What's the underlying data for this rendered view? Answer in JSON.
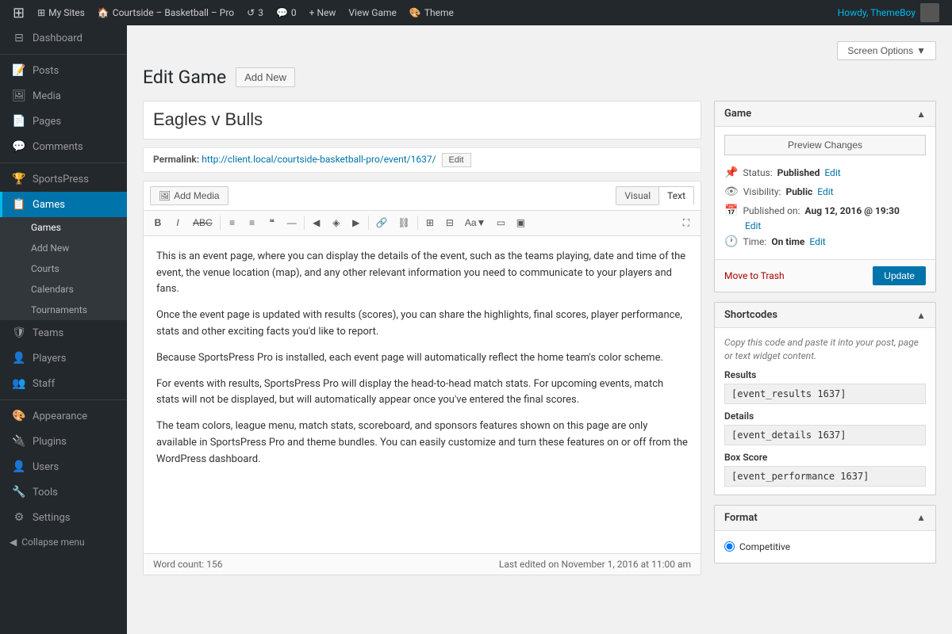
{
  "adminbar": {
    "wp_icon": "⊞",
    "items": [
      {
        "label": "My Sites",
        "icon": "⊞"
      },
      {
        "label": "Courtside – Basketball – Pro",
        "icon": "🏠"
      },
      {
        "label": "3",
        "icon": "↺"
      },
      {
        "label": "0",
        "icon": "💬"
      },
      {
        "label": "+ New",
        "icon": "+"
      },
      {
        "label": "View Game",
        "icon": ""
      },
      {
        "label": "Theme",
        "icon": "🎨"
      }
    ],
    "user": "Howdy, ThemeBoy"
  },
  "sidebar": {
    "items": [
      {
        "id": "dashboard",
        "label": "Dashboard",
        "icon": "⊟"
      },
      {
        "id": "posts",
        "label": "Posts",
        "icon": "📝"
      },
      {
        "id": "media",
        "label": "Media",
        "icon": "🖼"
      },
      {
        "id": "pages",
        "label": "Pages",
        "icon": "📄"
      },
      {
        "id": "comments",
        "label": "Comments",
        "icon": "💬"
      },
      {
        "id": "sportspress",
        "label": "SportsPress",
        "icon": "🏆"
      },
      {
        "id": "games",
        "label": "Games",
        "icon": "📋"
      },
      {
        "id": "teams",
        "label": "Teams",
        "icon": "🛡"
      },
      {
        "id": "players",
        "label": "Players",
        "icon": "👤"
      },
      {
        "id": "staff",
        "label": "Staff",
        "icon": "👥"
      },
      {
        "id": "appearance",
        "label": "Appearance",
        "icon": "🎨"
      },
      {
        "id": "plugins",
        "label": "Plugins",
        "icon": "🔌"
      },
      {
        "id": "users",
        "label": "Users",
        "icon": "👤"
      },
      {
        "id": "tools",
        "label": "Tools",
        "icon": "🔧"
      },
      {
        "id": "settings",
        "label": "Settings",
        "icon": "⚙"
      }
    ],
    "submenu": {
      "games": [
        "Games",
        "Add New",
        "Courts",
        "Calendars",
        "Tournaments"
      ]
    },
    "collapse_label": "Collapse menu"
  },
  "page": {
    "title": "Edit Game",
    "add_new_label": "Add New",
    "screen_options_label": "Screen Options"
  },
  "editor": {
    "post_title": "Eagles v Bulls",
    "permalink_label": "Permalink:",
    "permalink_url": "http://client.local/courtside-basketball-pro/event/1637/",
    "permalink_edit_label": "Edit",
    "add_media_label": "Add Media",
    "tab_visual": "Visual",
    "tab_text": "Text",
    "toolbar_buttons": [
      "B",
      "I",
      "ABC",
      "≡",
      "≡",
      "❝",
      "—",
      "◀",
      "▶",
      "◀▶",
      "🔗",
      "🔗✗",
      "⊞",
      "⊟",
      "Aa▼",
      "▭",
      "⬜"
    ],
    "expand_icon": "⛶",
    "content": [
      "This is an event page, where you can display the details of the event, such as the teams playing, date and time of the event, the venue location (map), and any other relevant information you need to communicate to your players and fans.",
      "Once the event page is updated with results (scores), you can share the highlights, final scores, player performance, stats and other exciting facts you'd like to report.",
      "Because SportsPress Pro is installed, each event page will automatically reflect the home team's color scheme.",
      "For events with results, SportsPress Pro will display the head-to-head match stats. For upcoming events, match stats will not be displayed, but will automatically appear once you've entered the final scores.",
      "The team colors, league menu, match stats, scoreboard, and sponsors features shown on this page are only available in SportsPress Pro and theme bundles. You can easily customize and turn these features on or off from the WordPress dashboard."
    ],
    "word_count_label": "Word count:",
    "word_count": "156",
    "last_edited": "Last edited on November 1, 2016 at 11:00 am"
  },
  "game_panel": {
    "title": "Game",
    "preview_label": "Preview Changes",
    "status_label": "Status:",
    "status_value": "Published",
    "status_edit": "Edit",
    "visibility_label": "Visibility:",
    "visibility_value": "Public",
    "visibility_edit": "Edit",
    "published_label": "Published on:",
    "published_value": "Aug 12, 2016 @ 19:30",
    "published_edit": "Edit",
    "time_label": "Time:",
    "time_value": "On time",
    "time_edit": "Edit",
    "trash_label": "Move to Trash",
    "update_label": "Update"
  },
  "shortcodes_panel": {
    "title": "Shortcodes",
    "intro": "Copy this code and paste it into your post, page or text widget content.",
    "results_label": "Results",
    "results_code": "[event_results 1637]",
    "details_label": "Details",
    "details_code": "[event_details 1637]",
    "boxscore_label": "Box Score",
    "boxscore_code": "[event_performance 1637]"
  },
  "format_panel": {
    "title": "Format",
    "options": [
      "Competitive"
    ]
  },
  "colors": {
    "sidebar_bg": "#23282d",
    "active_bg": "#0073aa",
    "link": "#0073aa",
    "update_btn": "#0073aa",
    "trash": "#a00"
  }
}
